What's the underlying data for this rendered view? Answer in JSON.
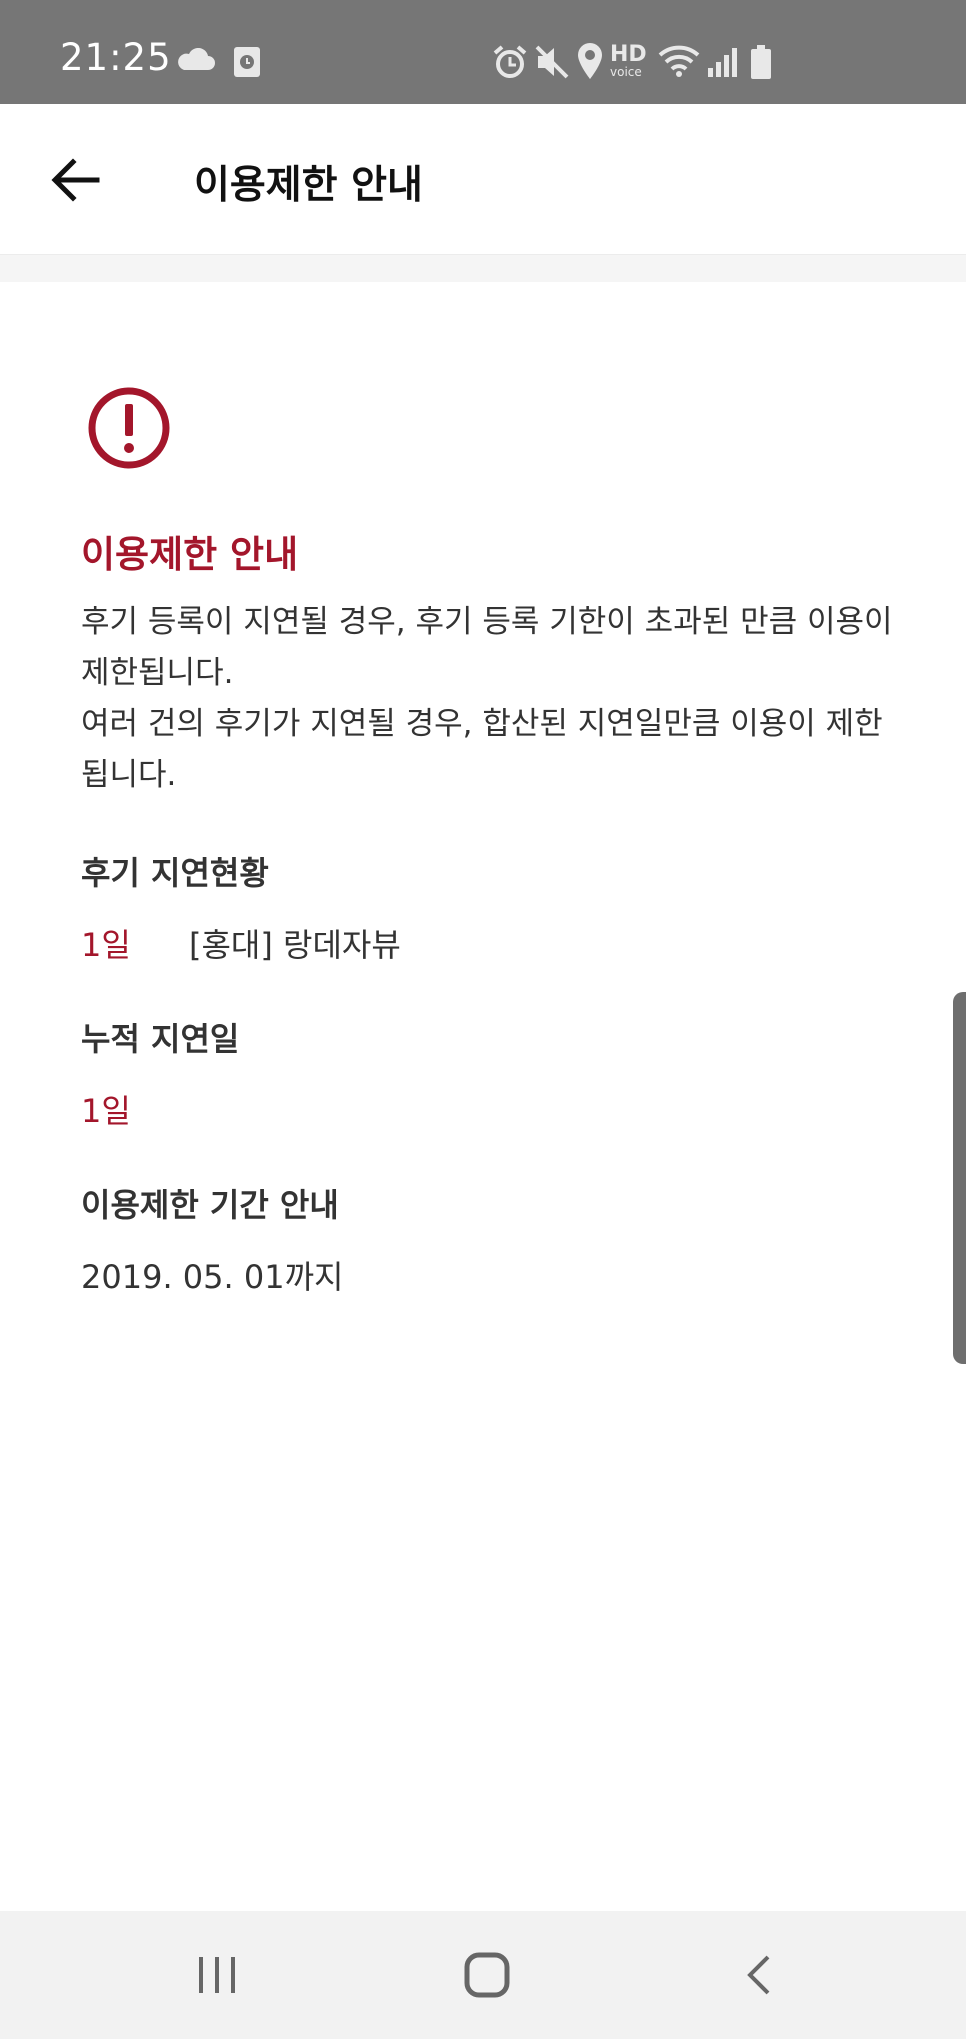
{
  "status_bar": {
    "time": "21:25",
    "hd_label": "HD",
    "voice_label": "voice",
    "icons": [
      "cloud-icon",
      "clock-box-icon",
      "alarm-icon",
      "mute-icon",
      "location-icon",
      "hd-voice-icon",
      "wifi-icon",
      "signal-icon",
      "battery-icon"
    ]
  },
  "header": {
    "title": "이용제한 안내"
  },
  "notice": {
    "heading": "이용제한 안내",
    "paragraph1": "후기 등록이 지연될 경우, 후기 등록 기한이 초과된 만큼 이용이 제한됩니다.",
    "paragraph2": "여러 건의 후기가 지연될 경우, 합산된 지연일만큼 이용이 제한됩니다."
  },
  "review_delay": {
    "title": "후기 지연현황",
    "items": [
      {
        "days": "1일",
        "name": "[홍대] 랑데자뷰"
      }
    ]
  },
  "accumulated": {
    "title": "누적 지연일",
    "value": "1일"
  },
  "restriction_period": {
    "title": "이용제한 기간 안내",
    "value": "2019. 05. 01까지"
  },
  "colors": {
    "accent": "#a3162b",
    "status_bar": "#767676",
    "text": "#333333",
    "nav_bar": "#f2f2f2"
  }
}
